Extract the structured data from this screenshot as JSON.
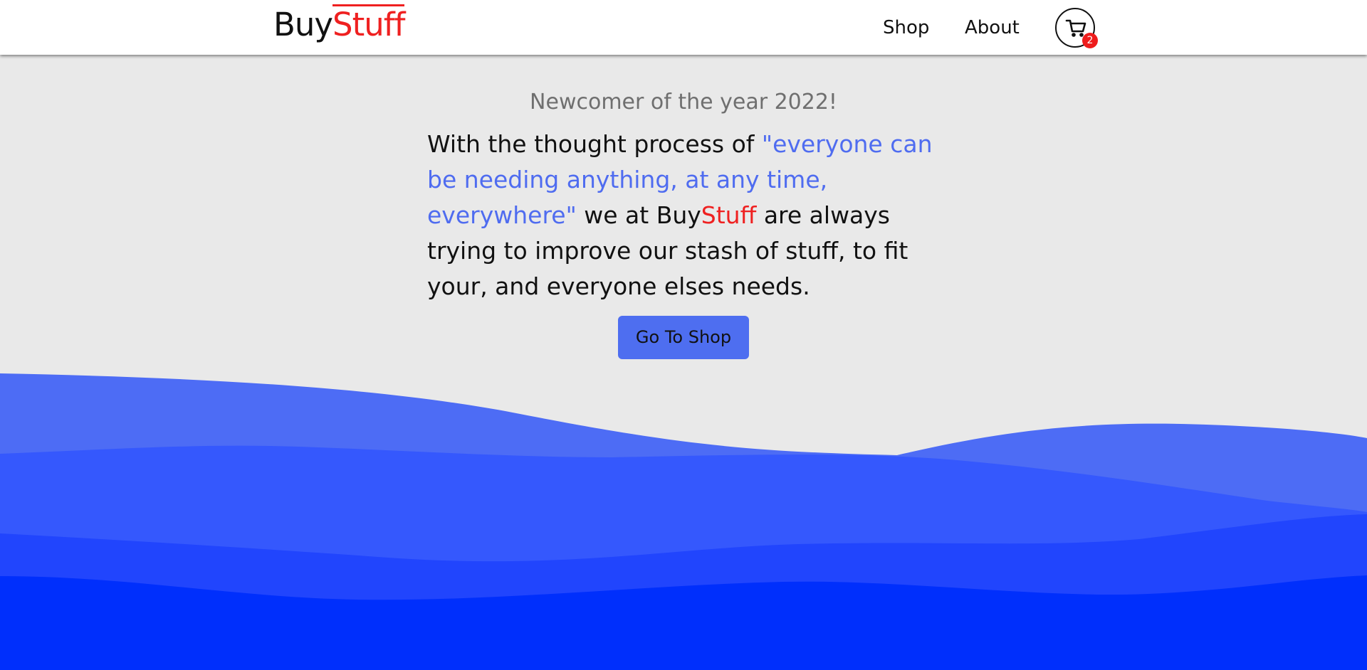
{
  "header": {
    "logo_buy": "Buy",
    "logo_stuff": "Stuff",
    "nav": [
      "Shop",
      "About"
    ],
    "cart_count": "2",
    "cart_icon": "cart-icon"
  },
  "hero": {
    "tagline": "Newcomer of the year 2022!",
    "intro_before": "With the thought process of ",
    "intro_quote": "\"everyone can be needing anything, at any time, everywhere\"",
    "intro_mid": " we at Buy",
    "intro_brand_red": "Stuff",
    "intro_after": " are always trying to improve our stash of stuff, to fit your, and everyone elses needs.",
    "cta_label": "Go To Shop"
  },
  "colors": {
    "background": "#e9e9e9",
    "brand_red": "#ef2020",
    "accent_blue": "#4e6ef0",
    "wave_1": "#4d6cf5",
    "wave_2": "#3558fd",
    "wave_3": "#2145fd",
    "wave_4": "#002ffc"
  }
}
